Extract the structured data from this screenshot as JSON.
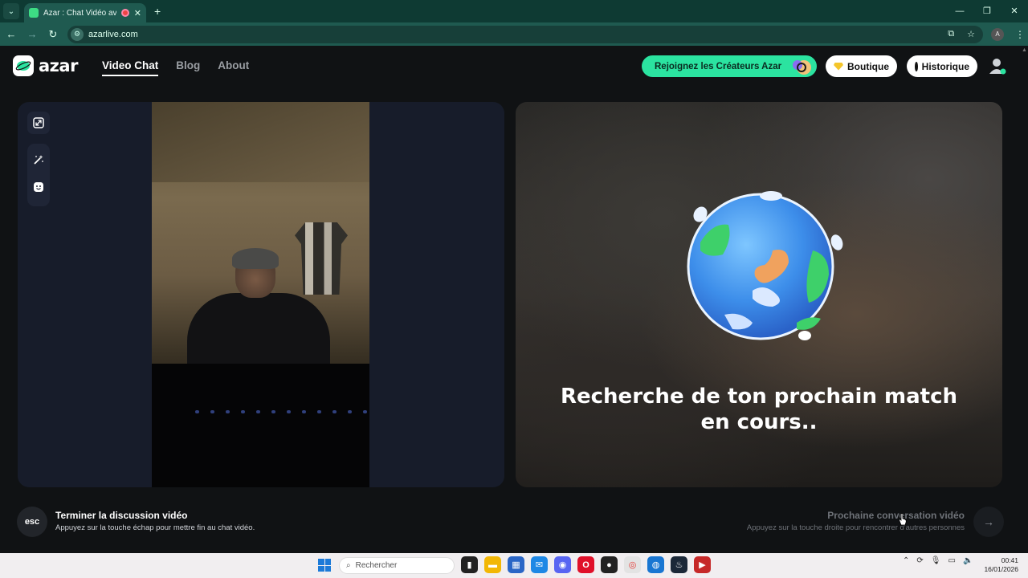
{
  "browser": {
    "tab_title": "Azar : Chat Vidéo avec de n",
    "new_tab": "+",
    "url": "azarlive.com",
    "profile_initial": "A",
    "window_controls": [
      "—",
      "❐",
      "✕"
    ]
  },
  "header": {
    "logo_text": "azar",
    "nav": [
      "Video Chat",
      "Blog",
      "About"
    ],
    "creators_label": "Rejoignez les Créateurs Azar",
    "shop_label": "Boutique",
    "history_label": "Historique"
  },
  "main": {
    "searching_text": "Recherche de ton prochain match en cours.."
  },
  "controls": {
    "esc_label": "esc",
    "end_title": "Terminer la discussion vidéo",
    "end_sub": "Appuyez sur la touche échap pour mettre fin au chat vidéo.",
    "next_title": "Prochaine conversation vidéo",
    "next_sub": "Appuyez sur la touche droite pour rencontrer d'autres personnes",
    "next_arrow": "→"
  },
  "taskbar": {
    "search_placeholder": "Rechercher",
    "time": "00:41",
    "date": "16/01/2026"
  },
  "colors": {
    "accent_green": "#2be3a0",
    "tab_bar": "#0e3a33",
    "address_bar": "#1f5a50"
  }
}
